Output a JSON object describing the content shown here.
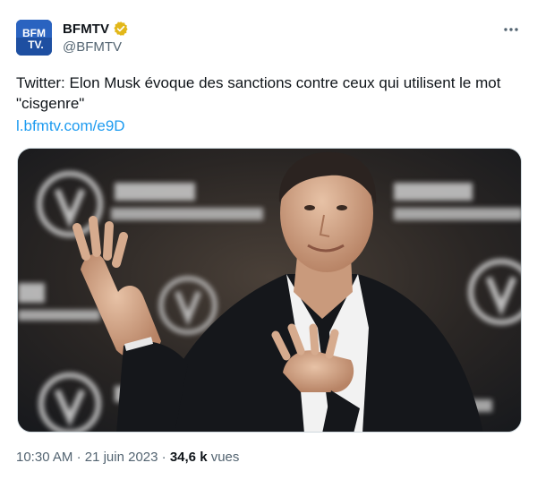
{
  "author": {
    "display_name": "BFMTV",
    "handle": "@BFMTV",
    "avatar_text_line1": "BFM",
    "avatar_text_line2": "TV.",
    "verified_color": "#e2b719"
  },
  "tweet": {
    "text": "Twitter: Elon Musk évoque des sanctions contre ceux qui utilisent le mot \"cisgenre\"",
    "link": "l.bfmtv.com/e9D"
  },
  "media": {
    "description_icon": "photo-image",
    "backdrop_text": "VIVA TECHNOLOGY"
  },
  "meta": {
    "time": "10:30 AM",
    "separator": "·",
    "date": "21 juin 2023",
    "views_count": "34,6 k",
    "views_label": "vues"
  },
  "colors": {
    "link": "#1d9bf0",
    "muted": "#536471",
    "text": "#0f1419",
    "brand": "#1e4fa1"
  },
  "icons": {
    "more": "more-horizontal-icon",
    "verified": "verified-badge-icon"
  }
}
